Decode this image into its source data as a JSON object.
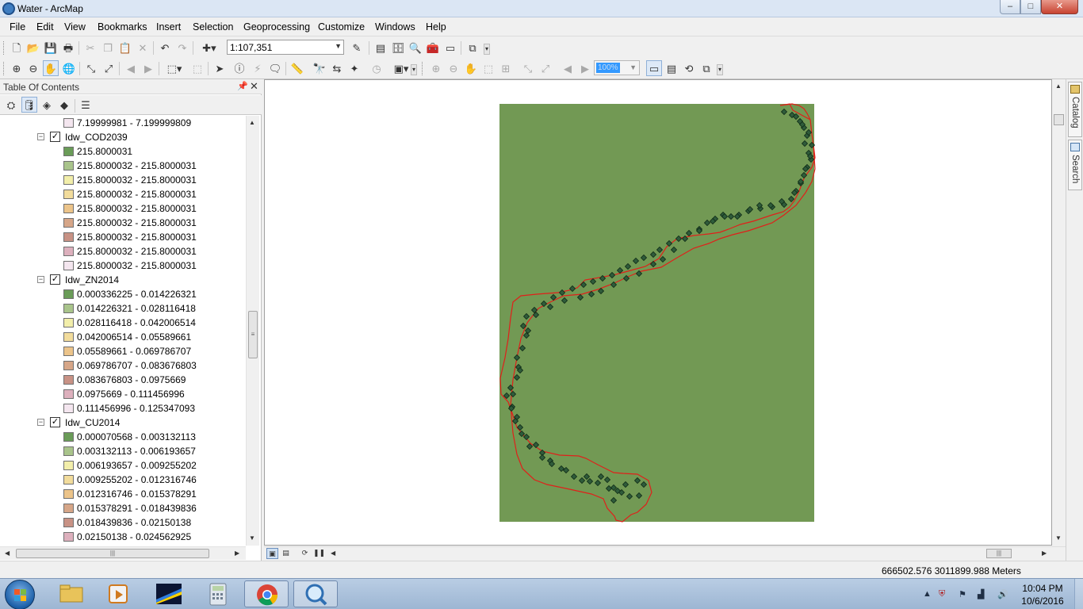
{
  "window": {
    "title": "Water - ArcMap",
    "app_icon": "arcmap-globe-icon",
    "controls": {
      "minimize": "–",
      "maximize": "□",
      "close": "✕"
    }
  },
  "menu": [
    "File",
    "Edit",
    "View",
    "Bookmarks",
    "Insert",
    "Selection",
    "Geoprocessing",
    "Customize",
    "Windows",
    "Help"
  ],
  "toolbar": {
    "scale_value": "1:107,351",
    "zoom_percent": "100%",
    "icons_row1": [
      "new-document-icon",
      "open-icon",
      "save-icon",
      "print-icon",
      "cut-icon",
      "copy-icon",
      "paste-icon",
      "delete-icon",
      "undo-icon",
      "redo-icon",
      "add-data-icon",
      "editor-toolbar-icon",
      "table-of-contents-icon",
      "catalog-window-icon",
      "search-window-icon",
      "arctoolbox-icon",
      "python-window-icon",
      "model-builder-icon"
    ],
    "icons_row2": [
      "zoom-in-icon",
      "zoom-out-icon",
      "pan-icon",
      "full-extent-icon",
      "fixed-zoom-in-icon",
      "fixed-zoom-out-icon",
      "back-extent-icon",
      "forward-extent-icon",
      "select-features-icon",
      "clear-selection-icon",
      "select-elements-icon",
      "identify-icon",
      "hyperlink-icon",
      "html-popup-icon",
      "measure-icon",
      "find-icon",
      "find-route-icon",
      "go-to-xy-icon",
      "time-slider-icon",
      "layout-toggle-icon"
    ]
  },
  "toc": {
    "title": "Table Of Contents",
    "pin_icon": "pin-icon",
    "close_icon": "close-icon",
    "tool_icons": [
      "list-by-drawing-order-icon",
      "list-by-source-icon",
      "list-by-visibility-icon",
      "list-by-selection-icon",
      "options-icon"
    ],
    "top_class": {
      "label": "7.19999981 - 7.199999809",
      "color": "#f4e6ef"
    },
    "layers": [
      {
        "name": "Idw_COD2039",
        "checked": true,
        "classes": [
          {
            "label": "215.8000031",
            "color": "#6a9c58"
          },
          {
            "label": "215.8000032 - 215.8000031",
            "color": "#a9c48b"
          },
          {
            "label": "215.8000032 - 215.8000031",
            "color": "#f2eeaa"
          },
          {
            "label": "215.8000032 - 215.8000031",
            "color": "#f2dc9c"
          },
          {
            "label": "215.8000032 - 215.8000031",
            "color": "#ecc48a"
          },
          {
            "label": "215.8000032 - 215.8000031",
            "color": "#d6a688"
          },
          {
            "label": "215.8000032 - 215.8000031",
            "color": "#c89285"
          },
          {
            "label": "215.8000032 - 215.8000031",
            "color": "#ddb0bd"
          },
          {
            "label": "215.8000032 - 215.8000031",
            "color": "#f4e6ef"
          }
        ]
      },
      {
        "name": "Idw_ZN2014",
        "checked": true,
        "classes": [
          {
            "label": "0.000336225 - 0.014226321",
            "color": "#6a9c58"
          },
          {
            "label": "0.014226321 - 0.028116418",
            "color": "#a9c48b"
          },
          {
            "label": "0.028116418 - 0.042006514",
            "color": "#f2eeaa"
          },
          {
            "label": "0.042006514 - 0.05589661",
            "color": "#f2dc9c"
          },
          {
            "label": "0.05589661 - 0.069786707",
            "color": "#ecc48a"
          },
          {
            "label": "0.069786707 - 0.083676803",
            "color": "#d6a688"
          },
          {
            "label": "0.083676803 - 0.0975669",
            "color": "#c89285"
          },
          {
            "label": "0.0975669 - 0.111456996",
            "color": "#ddb0bd"
          },
          {
            "label": "0.111456996 - 0.125347093",
            "color": "#f4e6ef"
          }
        ]
      },
      {
        "name": "Idw_CU2014",
        "checked": true,
        "classes": [
          {
            "label": "0.000070568 - 0.003132113",
            "color": "#6a9c58"
          },
          {
            "label": "0.003132113 - 0.006193657",
            "color": "#a9c48b"
          },
          {
            "label": "0.006193657 - 0.009255202",
            "color": "#f2eeaa"
          },
          {
            "label": "0.009255202 - 0.012316746",
            "color": "#f2dc9c"
          },
          {
            "label": "0.012316746 - 0.015378291",
            "color": "#ecc48a"
          },
          {
            "label": "0.015378291 - 0.018439836",
            "color": "#d6a688"
          },
          {
            "label": "0.018439836 - 0.02150138",
            "color": "#c89285"
          },
          {
            "label": "0.02150138 - 0.024562925",
            "color": "#ddb0bd"
          }
        ]
      }
    ]
  },
  "map": {
    "raster_color": "#729954",
    "boundary_color": "#e0201a",
    "point_color": "#2f5b3a"
  },
  "side_tabs": [
    "Catalog",
    "Search"
  ],
  "status": {
    "coordinates": "666502.576  3011899.988 Meters"
  },
  "taskbar": {
    "start_icon": "windows-start-orb-icon",
    "apps": [
      "file-explorer-icon",
      "media-player-icon",
      "arcgis-app-icon",
      "calculator-icon",
      "chrome-icon",
      "arcmap-icon"
    ],
    "tray_icons": [
      "show-hidden-icons-icon",
      "security-icon",
      "flag-icon",
      "network-icon",
      "volume-icon"
    ],
    "time": "10:04 PM",
    "date": "10/6/2016"
  }
}
